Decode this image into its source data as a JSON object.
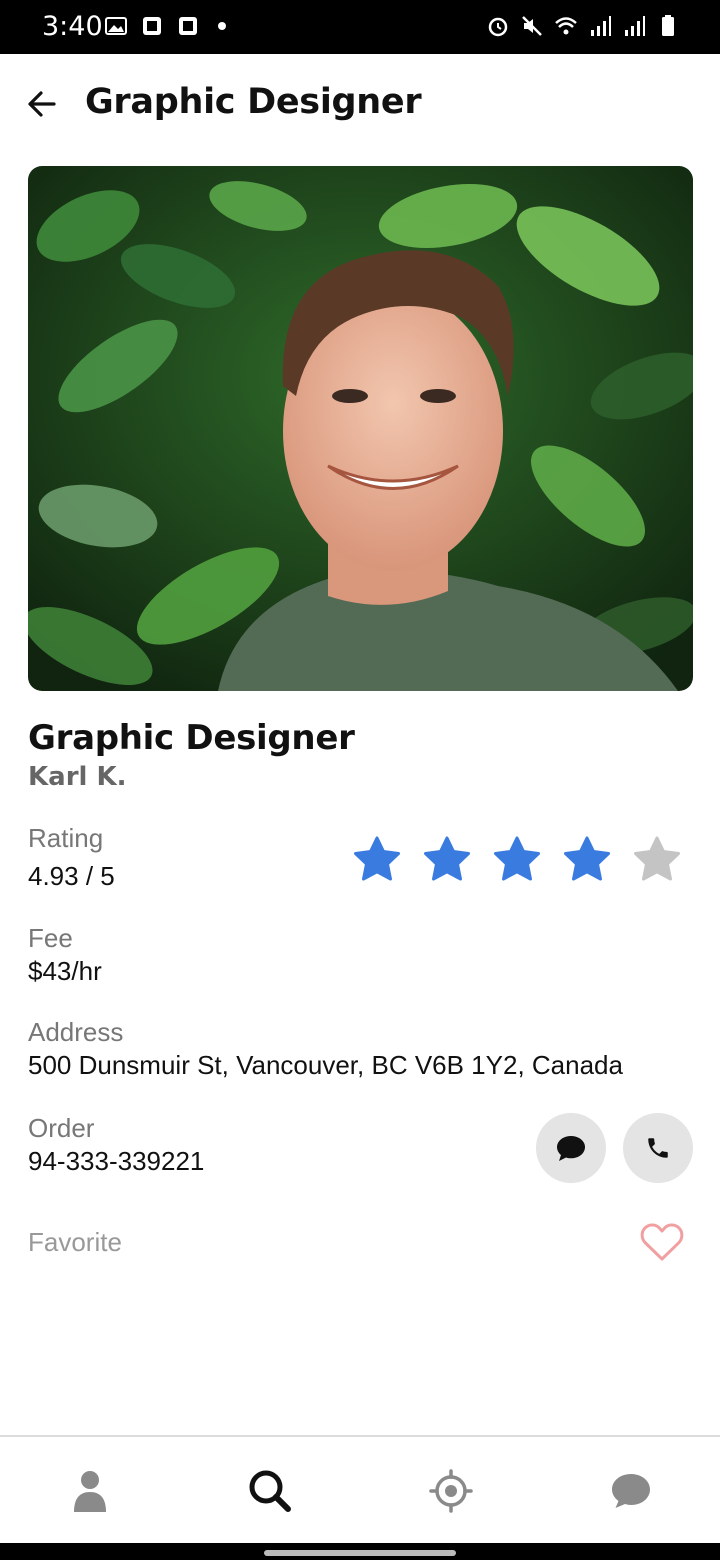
{
  "status_bar": {
    "time": "3:40",
    "left_icons": [
      "image-icon",
      "notification-icon",
      "notification-icon",
      "dot-icon"
    ],
    "right_icons": [
      "alarm-icon",
      "mute-icon",
      "wifi-icon",
      "signal-icon",
      "signal-icon",
      "battery-icon"
    ]
  },
  "header": {
    "title": "Graphic Designer",
    "back_icon": "arrow-left-icon"
  },
  "profile": {
    "title": "Graphic Designer",
    "name": "Karl K."
  },
  "details": {
    "rating_label": "Rating",
    "rating_value": "4.93 / 5",
    "rating_stars": 4,
    "rating_stars_max": 5,
    "fee_label": "Fee",
    "fee_value": "$43/hr",
    "address_label": "Address",
    "address_value": "500 Dunsmuir St, Vancouver, BC V6B 1Y2, Canada",
    "order_label": "Order",
    "order_value": "94-333-339221",
    "favorite_label": "Favorite"
  },
  "actions": {
    "message_icon": "chat-bubble-icon",
    "call_icon": "phone-icon",
    "favorite_icon": "heart-outline-icon"
  },
  "bottom_nav": {
    "items": [
      "person-icon",
      "search-icon",
      "location-target-icon",
      "chat-icon"
    ],
    "active": "search-icon"
  },
  "colors": {
    "star_active": "#3a7be0",
    "star_inactive": "#c4c4c4",
    "heart": "#f0a0a0",
    "nav_inactive": "#8a8a8a",
    "nav_active": "#111111"
  }
}
